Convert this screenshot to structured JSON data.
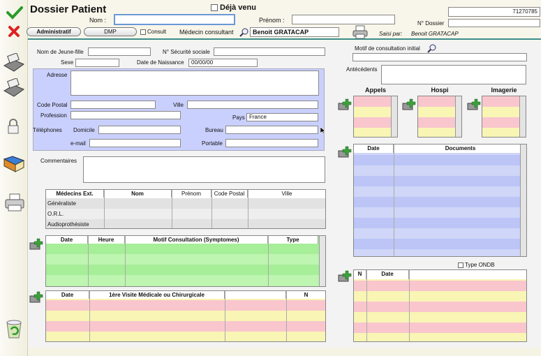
{
  "header": {
    "title": "Dossier Patient",
    "deja_venu": "Déjà venu",
    "nom_label": "Nom :",
    "nom_value": "",
    "prenom_label": "Prénom :",
    "prenom_value": "",
    "dossier_number": "71270785",
    "dossier_label": "N° Dossier",
    "dossier_value": "",
    "btn_administratif": "Administratif",
    "btn_dmp": "DMP",
    "consult_label": "Consult",
    "medecin_label": "Médecin consultant",
    "medecin_value": "Benoit GRATACAP",
    "saisi_label": "Saisi par:",
    "saisi_value": "Benoit GRATACAP"
  },
  "identity": {
    "nom_jf_label": "Nom de Jeune-fille",
    "secu_label": "N° Sécurité sociale",
    "sexe_label": "Sexe",
    "dob_label": "Date de Naissance",
    "dob_value": "00/00/00"
  },
  "address": {
    "adresse_label": "Adresse",
    "cp_label": "Code Postal",
    "ville_label": "Ville",
    "profession_label": "Profession",
    "pays_label": "Pays",
    "pays_value": "France",
    "tel_label": "Téléphones",
    "domicile_label": "Domicile",
    "bureau_label": "Bureau",
    "email_label": "e-mail",
    "portable_label": "Portable"
  },
  "commentaires_label": "Commentaires",
  "medecins_table": {
    "headers": [
      "Médecins Ext.",
      "Nom",
      "Prénom",
      "Code Postal",
      "Ville"
    ],
    "rows": [
      "Généraliste",
      "O.R.L.",
      "Audioprothésiste"
    ]
  },
  "consult_table": {
    "headers": [
      "Date",
      "Heure",
      "Motif Consultation (Symptomes)",
      "Type"
    ]
  },
  "visite_table": {
    "headers": [
      "Date",
      "1ère Visite Médicale ou Chirurgicale",
      "",
      "N"
    ]
  },
  "right": {
    "motif_label": "Motif de consultation initial",
    "antecedents_label": "Antécédents",
    "appels": "Appels",
    "hospi": "Hospi",
    "imagerie": "Imagerie",
    "docs_headers": [
      "Date",
      "Documents"
    ],
    "type_ondb": "Type ONDB",
    "ondb_headers": [
      "N",
      "Date"
    ]
  },
  "colors": {
    "blue_panel": "#cad0fd",
    "green_rows": "#b0f2a4",
    "pink": "#f9c6cd",
    "yellow": "#f8f5b5",
    "lavender": "#cfd6f8"
  }
}
